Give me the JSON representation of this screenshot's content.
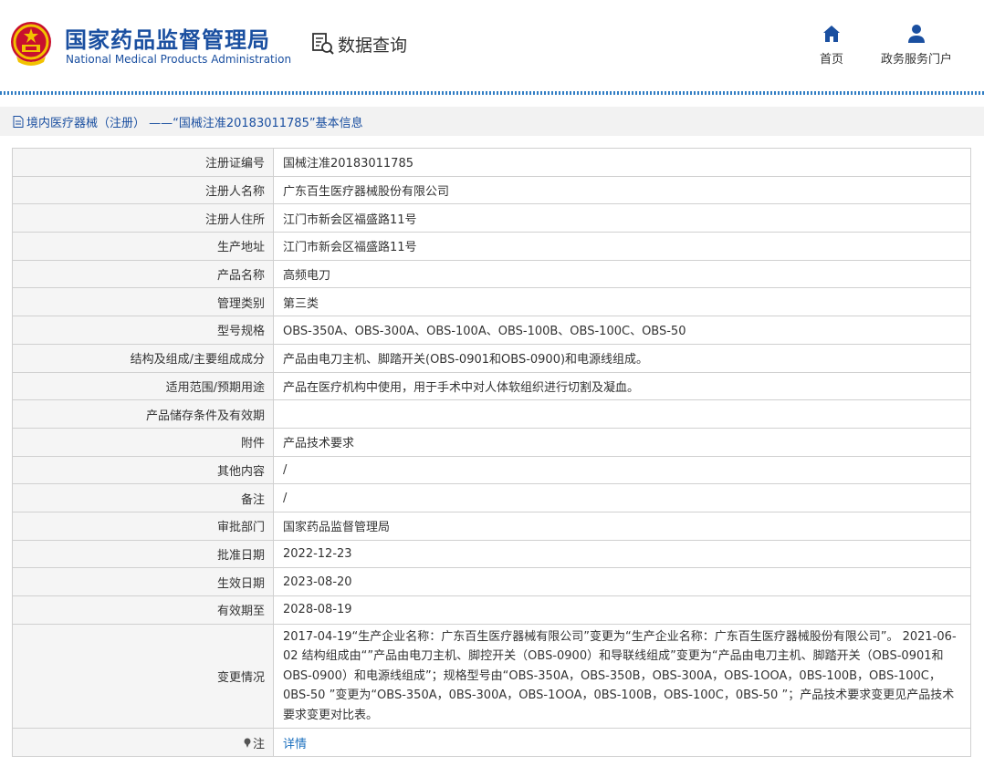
{
  "header": {
    "org_name_cn": "国家药品监督管理局",
    "org_name_en": "National Medical Products Administration",
    "query_label": "数据查询",
    "nav": [
      {
        "label": "首页",
        "icon": "home-icon"
      },
      {
        "label": "政务服务门户",
        "icon": "user-icon"
      }
    ]
  },
  "breadcrumb": {
    "text": "境内医疗器械（注册） ——“国械注准20183011785”基本信息",
    "icon": "document-icon"
  },
  "record": {
    "rows": [
      {
        "label": "注册证编号",
        "value": "国械注准20183011785"
      },
      {
        "label": "注册人名称",
        "value": "广东百生医疗器械股份有限公司"
      },
      {
        "label": "注册人住所",
        "value": "江门市新会区福盛路11号"
      },
      {
        "label": "生产地址",
        "value": "江门市新会区福盛路11号"
      },
      {
        "label": "产品名称",
        "value": "高频电刀"
      },
      {
        "label": "管理类别",
        "value": "第三类"
      },
      {
        "label": "型号规格",
        "value": "OBS-350A、OBS-300A、OBS-100A、OBS-100B、OBS-100C、OBS-50"
      },
      {
        "label": "结构及组成/主要组成成分",
        "value": "产品由电刀主机、脚踏开关(OBS-0901和OBS-0900)和电源线组成。"
      },
      {
        "label": "适用范围/预期用途",
        "value": "产品在医疗机构中使用，用于手术中对人体软组织进行切割及凝血。"
      },
      {
        "label": "产品储存条件及有效期",
        "value": ""
      },
      {
        "label": "附件",
        "value": "产品技术要求"
      },
      {
        "label": "其他内容",
        "value": "/"
      },
      {
        "label": "备注",
        "value": "/"
      },
      {
        "label": "审批部门",
        "value": "国家药品监督管理局"
      },
      {
        "label": "批准日期",
        "value": "2022-12-23"
      },
      {
        "label": "生效日期",
        "value": "2023-08-20"
      },
      {
        "label": "有效期至",
        "value": "2028-08-19"
      }
    ],
    "change": {
      "label": "变更情况",
      "value": "2017-04-19“生产企业名称：广东百生医疗器械有限公司”变更为“生产企业名称：广东百生医疗器械股份有限公司”。 2021-06-02 结构组成由“”产品由电刀主机、脚控开关（OBS-0900）和导联线组成”变更为“产品由电刀主机、脚踏开关（OBS-0901和OBS-0900）和电源线组成”；规格型号由“OBS-350A，OBS-350B，OBS-300A，OBS-1OOA，0BS-100B，OBS-100C，0BS-50 ”变更为“OBS-350A，0BS-300A，OBS-1OOA，0BS-100B，OBS-100C，0BS-50 ”；产品技术要求变更见产品技术要求变更对比表。"
    },
    "note": {
      "label": "注",
      "link_text": "详情",
      "icon": "pin-icon"
    }
  },
  "colors": {
    "brand_blue": "#1a4fa0",
    "link_blue": "#1a6fbe",
    "label_bg": "#f5f5f5",
    "border": "#d0d0d0"
  }
}
